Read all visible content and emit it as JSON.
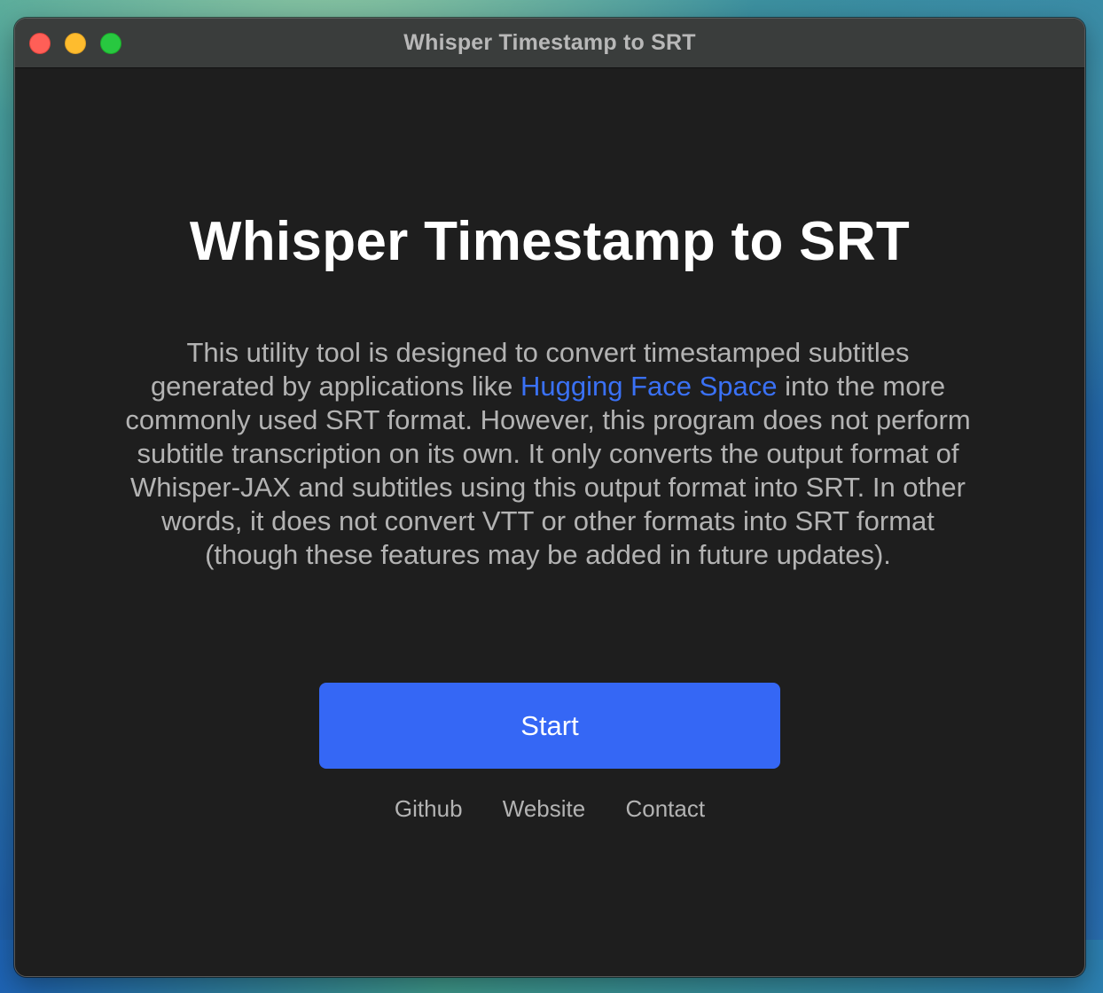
{
  "window": {
    "title": "Whisper Timestamp to SRT"
  },
  "main": {
    "heading": "Whisper Timestamp to SRT",
    "description_before_link": "This utility tool is designed to convert timestamped subtitles generated by applications like ",
    "description_link": "Hugging Face Space",
    "description_after_link": " into the more commonly used SRT format. However, this program does not perform subtitle transcription on its own. It only converts the output format of Whisper-JAX and subtitles using this output format into SRT. In other words, it does not convert VTT or other formats into SRT format (though these features may be added in future updates).",
    "start_label": "Start"
  },
  "footer": {
    "links": [
      "Github",
      "Website",
      "Contact"
    ]
  },
  "colors": {
    "window_background": "#1e1e1e",
    "titlebar_background": "#3a3d3c",
    "accent": "#3567f5",
    "link": "#3a71f5",
    "body_text": "#b3b3b3"
  }
}
